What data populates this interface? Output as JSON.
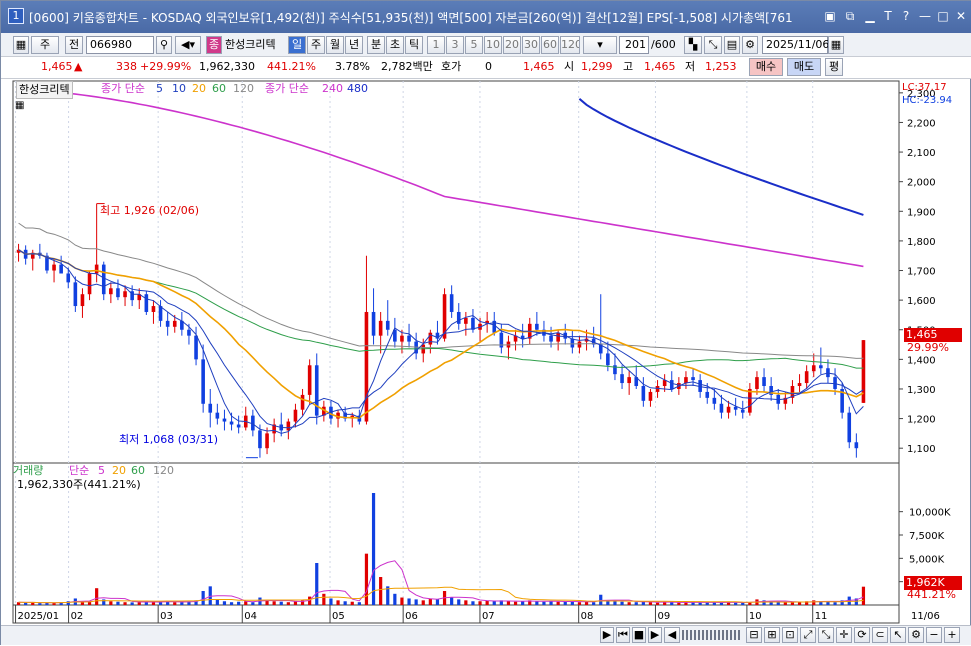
{
  "title": {
    "num": "1",
    "text": "[0600] 키움종합차트 - KOSDAQ 외국인보유[1,492(천)] 주식수[51,935(천)] 액면[500] 자본금[260(억)] 결산[12월] EPS[-1,508] 시가총액[761"
  },
  "toolbar": {
    "period_unit": "주",
    "prev": "전",
    "code": "066980",
    "stock_name": "한성크리텍",
    "mode_icon": "종",
    "tabs": [
      "일",
      "주",
      "월",
      "년",
      "분",
      "초",
      "틱"
    ],
    "intervals": [
      "1",
      "3",
      "5",
      "10",
      "20",
      "30",
      "60",
      "120"
    ],
    "count": "201",
    "total": "/600",
    "date": "2025/11/06"
  },
  "quote": {
    "price": "1,465",
    "change": "338",
    "rate": "+29.99%",
    "volume": "1,962,330",
    "vol_rate": "441.21%",
    "turnover": "3.78%",
    "amount": "2,782백만",
    "hoga_label": "호가",
    "hoga": "0",
    "ask": "1,465",
    "open_label": "시",
    "open": "1,299",
    "high_label": "고",
    "high": "1,465",
    "low_label": "저",
    "low": "1,253",
    "buy": "매수",
    "sell": "매도",
    "eval": "평"
  },
  "legend": {
    "name": "한성크리텍",
    "ma_label": "종가 단순",
    "ma": [
      "5",
      "10",
      "20",
      "60",
      "120"
    ],
    "ma2_label": "종가 단순",
    "ma2": [
      "240",
      "480"
    ],
    "lc": "LC:37.17",
    "hc": "HC:-23.94",
    "max_label": "최고 1,926 (02/06)",
    "min_label": "최저 1,068 (03/31)",
    "price_tag": "1,465",
    "rate_tag": "29.99%"
  },
  "vlegend": {
    "label": "거래량",
    "ma_label": "단순",
    "ma": [
      "5",
      "20",
      "60",
      "120"
    ],
    "value": "1,962,330주(441.21%)",
    "vol_tag": "1,962K",
    "rate_tag": "441.21%"
  },
  "colors": {
    "ma5": "#1f3fbf",
    "ma10": "#1f3fbf",
    "ma20": "#f0a000",
    "ma60": "#2e9e4a",
    "ma120": "#888888",
    "ma240": "#cc33cc",
    "ma480": "#1a2ec8",
    "up": "#e00000",
    "down": "#1040e0"
  },
  "chart_data": {
    "type": "candlestick",
    "y_ticks": [
      "2,300",
      "2,200",
      "2,100",
      "2,000",
      "1,900",
      "1,800",
      "1,700",
      "1,600",
      "1,500",
      "1,400",
      "1,300",
      "1,200",
      "1,100"
    ],
    "x_ticks": [
      "2025/01",
      "02",
      "03",
      "04",
      "05",
      "06",
      "07",
      "08",
      "09",
      "10",
      "11",
      "11/06"
    ],
    "vol_ticks": [
      "10,000K",
      "7,500K",
      "5,000K",
      "2,500K"
    ],
    "ylim": [
      1050,
      2340
    ],
    "vol_max": 12000,
    "ohlc": [
      [
        1760,
        1790,
        1730,
        1770
      ],
      [
        1770,
        1785,
        1720,
        1740
      ],
      [
        1740,
        1770,
        1700,
        1760
      ],
      [
        1760,
        1790,
        1740,
        1750
      ],
      [
        1750,
        1760,
        1690,
        1700
      ],
      [
        1700,
        1740,
        1660,
        1720
      ],
      [
        1720,
        1750,
        1690,
        1690
      ],
      [
        1690,
        1710,
        1640,
        1660
      ],
      [
        1660,
        1680,
        1560,
        1580
      ],
      [
        1580,
        1640,
        1540,
        1620
      ],
      [
        1620,
        1700,
        1600,
        1690
      ],
      [
        1690,
        1926,
        1660,
        1720
      ],
      [
        1720,
        1730,
        1600,
        1620
      ],
      [
        1620,
        1660,
        1590,
        1640
      ],
      [
        1640,
        1670,
        1600,
        1610
      ],
      [
        1610,
        1650,
        1580,
        1630
      ],
      [
        1630,
        1650,
        1580,
        1600
      ],
      [
        1600,
        1640,
        1570,
        1620
      ],
      [
        1620,
        1630,
        1550,
        1560
      ],
      [
        1560,
        1600,
        1520,
        1580
      ],
      [
        1580,
        1600,
        1510,
        1530
      ],
      [
        1530,
        1560,
        1480,
        1510
      ],
      [
        1510,
        1550,
        1490,
        1530
      ],
      [
        1530,
        1560,
        1480,
        1500
      ],
      [
        1500,
        1520,
        1450,
        1480
      ],
      [
        1480,
        1510,
        1380,
        1400
      ],
      [
        1400,
        1450,
        1220,
        1250
      ],
      [
        1250,
        1300,
        1170,
        1220
      ],
      [
        1220,
        1250,
        1180,
        1200
      ],
      [
        1200,
        1230,
        1160,
        1190
      ],
      [
        1190,
        1220,
        1160,
        1180
      ],
      [
        1180,
        1210,
        1150,
        1170
      ],
      [
        1170,
        1240,
        1160,
        1210
      ],
      [
        1210,
        1230,
        1140,
        1160
      ],
      [
        1160,
        1180,
        1068,
        1100
      ],
      [
        1100,
        1170,
        1080,
        1150
      ],
      [
        1150,
        1200,
        1120,
        1180
      ],
      [
        1180,
        1220,
        1140,
        1160
      ],
      [
        1160,
        1200,
        1130,
        1190
      ],
      [
        1190,
        1250,
        1170,
        1230
      ],
      [
        1230,
        1300,
        1210,
        1280
      ],
      [
        1280,
        1400,
        1250,
        1380
      ],
      [
        1380,
        1420,
        1180,
        1210
      ],
      [
        1210,
        1260,
        1190,
        1240
      ],
      [
        1240,
        1260,
        1180,
        1200
      ],
      [
        1200,
        1230,
        1170,
        1220
      ],
      [
        1220,
        1240,
        1190,
        1200
      ],
      [
        1200,
        1220,
        1170,
        1210
      ],
      [
        1210,
        1230,
        1180,
        1190
      ],
      [
        1190,
        1750,
        1180,
        1560
      ],
      [
        1560,
        1640,
        1450,
        1480
      ],
      [
        1480,
        1560,
        1420,
        1530
      ],
      [
        1530,
        1600,
        1480,
        1500
      ],
      [
        1500,
        1540,
        1440,
        1460
      ],
      [
        1460,
        1500,
        1420,
        1480
      ],
      [
        1480,
        1520,
        1440,
        1460
      ],
      [
        1460,
        1490,
        1400,
        1420
      ],
      [
        1420,
        1470,
        1390,
        1450
      ],
      [
        1450,
        1500,
        1420,
        1490
      ],
      [
        1490,
        1530,
        1450,
        1470
      ],
      [
        1470,
        1640,
        1460,
        1620
      ],
      [
        1620,
        1650,
        1540,
        1560
      ],
      [
        1560,
        1590,
        1500,
        1520
      ],
      [
        1520,
        1560,
        1480,
        1540
      ],
      [
        1540,
        1570,
        1490,
        1500
      ],
      [
        1500,
        1540,
        1460,
        1520
      ],
      [
        1520,
        1560,
        1490,
        1530
      ],
      [
        1530,
        1560,
        1480,
        1490
      ],
      [
        1490,
        1520,
        1420,
        1440
      ],
      [
        1440,
        1480,
        1400,
        1460
      ],
      [
        1460,
        1500,
        1430,
        1480
      ],
      [
        1480,
        1520,
        1440,
        1470
      ],
      [
        1470,
        1540,
        1450,
        1520
      ],
      [
        1520,
        1560,
        1480,
        1500
      ],
      [
        1500,
        1530,
        1460,
        1480
      ],
      [
        1480,
        1510,
        1440,
        1460
      ],
      [
        1460,
        1500,
        1430,
        1490
      ],
      [
        1490,
        1520,
        1450,
        1470
      ],
      [
        1470,
        1500,
        1420,
        1440
      ],
      [
        1440,
        1480,
        1420,
        1460
      ],
      [
        1460,
        1500,
        1430,
        1470
      ],
      [
        1470,
        1510,
        1440,
        1450
      ],
      [
        1450,
        1620,
        1400,
        1420
      ],
      [
        1420,
        1460,
        1360,
        1380
      ],
      [
        1380,
        1420,
        1330,
        1350
      ],
      [
        1350,
        1380,
        1300,
        1320
      ],
      [
        1320,
        1360,
        1280,
        1340
      ],
      [
        1340,
        1380,
        1300,
        1310
      ],
      [
        1310,
        1340,
        1240,
        1260
      ],
      [
        1260,
        1300,
        1240,
        1290
      ],
      [
        1290,
        1330,
        1270,
        1310
      ],
      [
        1310,
        1350,
        1290,
        1330
      ],
      [
        1330,
        1360,
        1290,
        1300
      ],
      [
        1300,
        1340,
        1280,
        1320
      ],
      [
        1320,
        1360,
        1300,
        1340
      ],
      [
        1340,
        1370,
        1310,
        1330
      ],
      [
        1330,
        1350,
        1270,
        1290
      ],
      [
        1290,
        1320,
        1250,
        1270
      ],
      [
        1270,
        1300,
        1230,
        1250
      ],
      [
        1250,
        1280,
        1200,
        1220
      ],
      [
        1220,
        1260,
        1200,
        1240
      ],
      [
        1240,
        1270,
        1210,
        1230
      ],
      [
        1230,
        1260,
        1200,
        1220
      ],
      [
        1220,
        1320,
        1210,
        1300
      ],
      [
        1300,
        1360,
        1280,
        1340
      ],
      [
        1340,
        1370,
        1290,
        1310
      ],
      [
        1310,
        1340,
        1260,
        1280
      ],
      [
        1280,
        1300,
        1230,
        1250
      ],
      [
        1250,
        1290,
        1230,
        1270
      ],
      [
        1270,
        1330,
        1250,
        1310
      ],
      [
        1310,
        1350,
        1290,
        1320
      ],
      [
        1320,
        1380,
        1300,
        1360
      ],
      [
        1360,
        1420,
        1340,
        1380
      ],
      [
        1380,
        1440,
        1350,
        1370
      ],
      [
        1370,
        1400,
        1320,
        1340
      ],
      [
        1340,
        1370,
        1280,
        1300
      ],
      [
        1300,
        1320,
        1200,
        1220
      ],
      [
        1220,
        1240,
        1100,
        1120
      ],
      [
        1120,
        1150,
        1068,
        1100
      ],
      [
        1253,
        1465,
        1253,
        1465
      ]
    ],
    "volume": [
      300,
      250,
      280,
      200,
      260,
      220,
      300,
      400,
      700,
      350,
      400,
      1800,
      600,
      400,
      350,
      300,
      280,
      300,
      400,
      350,
      300,
      380,
      300,
      280,
      400,
      500,
      1500,
      2000,
      600,
      400,
      300,
      350,
      400,
      300,
      800,
      500,
      400,
      350,
      300,
      400,
      500,
      900,
      4500,
      1200,
      700,
      500,
      400,
      350,
      300,
      5500,
      12000,
      3000,
      2000,
      1200,
      800,
      700,
      600,
      500,
      700,
      600,
      1500,
      800,
      600,
      500,
      400,
      400,
      450,
      400,
      500,
      400,
      350,
      400,
      500,
      400,
      350,
      400,
      350,
      400,
      350,
      300,
      350,
      300,
      1100,
      500,
      400,
      350,
      300,
      300,
      400,
      300,
      250,
      280,
      300,
      250,
      300,
      280,
      250,
      300,
      280,
      250,
      300,
      250,
      280,
      300,
      600,
      500,
      400,
      350,
      300,
      280,
      300,
      400,
      500,
      400,
      350,
      300,
      500,
      900,
      700,
      1962
    ]
  }
}
